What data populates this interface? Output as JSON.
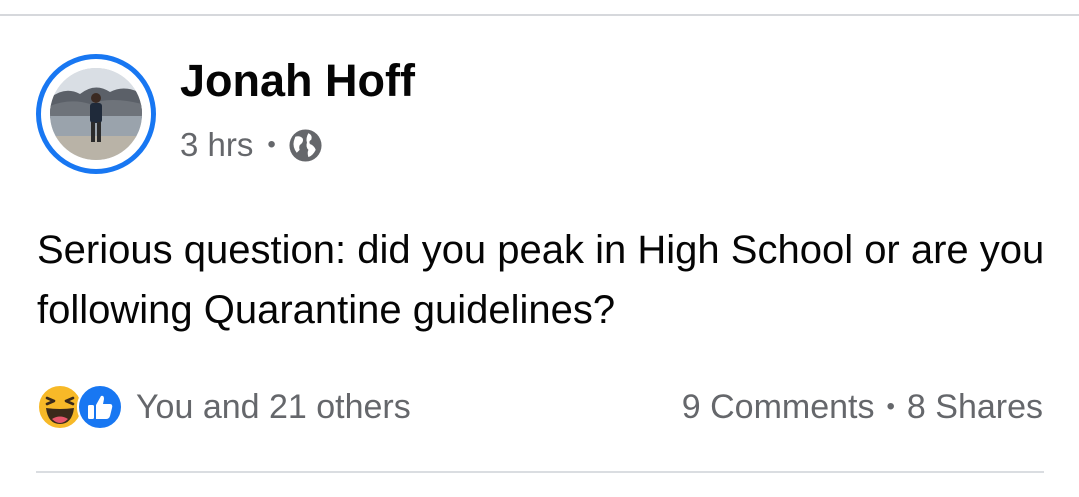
{
  "post": {
    "author": "Jonah Hoff",
    "timestamp": "3 hrs",
    "separator": "•",
    "audience_icon": "globe-icon",
    "text": "Serious question: did you peak in High School or are you following Quarantine guidelines?"
  },
  "reactions": {
    "icons": [
      "haha-icon",
      "like-icon"
    ],
    "summary": "You and 21 others"
  },
  "stats": {
    "comments": "9 Comments",
    "separator": "•",
    "shares": "8 Shares"
  },
  "colors": {
    "accent": "#1877f2",
    "text_primary": "#050505",
    "text_secondary": "#65676b",
    "haha_yellow": "#f7b928",
    "divider": "#d6d8dc"
  }
}
